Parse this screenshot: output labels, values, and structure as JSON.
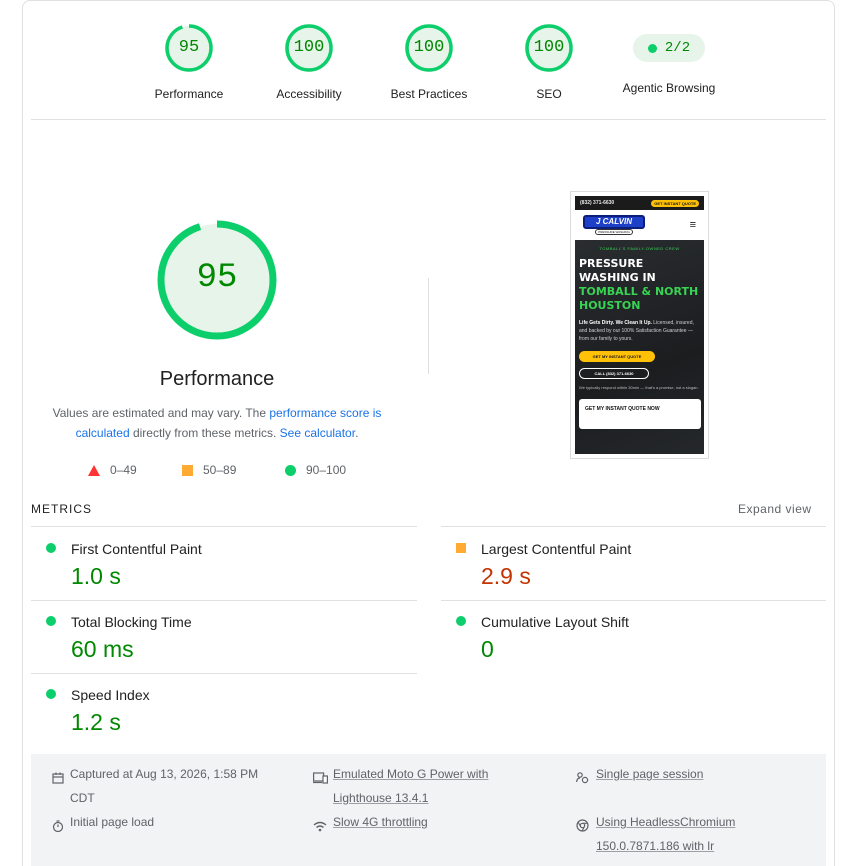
{
  "gauges": [
    {
      "score": "95",
      "label": "Performance"
    },
    {
      "score": "100",
      "label": "Accessibility"
    },
    {
      "score": "100",
      "label": "Best Practices"
    },
    {
      "score": "100",
      "label": "SEO"
    }
  ],
  "agentic": {
    "value": "2/2",
    "label": "Agentic Browsing"
  },
  "main": {
    "score": "95",
    "score_fraction": 0.95,
    "title": "Performance",
    "desc_part1": "Values are estimated and may vary. The ",
    "desc_link1": "performance score is calculated",
    "desc_part2": " directly from these metrics. ",
    "desc_link2": "See calculator",
    "desc_part3": "."
  },
  "legend": {
    "fail": "0–49",
    "average": "50–89",
    "pass": "90–100"
  },
  "colors": {
    "pass": "#0cce6b",
    "average": "#ffaa33",
    "fail": "#ff3333",
    "pass_text": "#008800",
    "average_text": "#c33300",
    "link": "#1a73e8"
  },
  "screenshot": {
    "phone": "(832) 371-6630",
    "top_button": "GET INSTANT QUOTE",
    "logo": "J CALVIN",
    "logo_sub": "PRESSURE WASHING",
    "eyebrow": "TOMBALL'S FAMILY-OWNED CREW",
    "headline_white": "PRESSURE WASHING IN",
    "headline_green1": "TOMBALL & NORTH",
    "headline_green2": "HOUSTON",
    "para_bold": "Life Gets Dirty. We Clean It Up.",
    "para_rest": " Licensed, insured, and backed by our 100% Satisfaction Guarantee — from our family to yours.",
    "btn_quote": "GET MY INSTANT QUOTE",
    "btn_call": "CALL (832) 371-6630",
    "small_note": "We typically respond within 30min — that's a promise, not a slogan.",
    "card_title": "GET MY INSTANT QUOTE NOW"
  },
  "metrics": {
    "heading": "METRICS",
    "expand": "Expand view",
    "fcp": {
      "name": "First Contentful Paint",
      "value": "1.0 s"
    },
    "lcp": {
      "name": "Largest Contentful Paint",
      "value": "2.9 s"
    },
    "tbt": {
      "name": "Total Blocking Time",
      "value": "60 ms"
    },
    "cls": {
      "name": "Cumulative Layout Shift",
      "value": "0"
    },
    "si": {
      "name": "Speed Index",
      "value": "1.2 s"
    }
  },
  "footer": {
    "captured": "Captured at Aug 13, 2026, 1:58 PM CDT",
    "emulated": "Emulated Moto G Power with Lighthouse 13.4.1",
    "session": "Single page session",
    "load": "Initial page load",
    "throttling": "Slow 4G throttling",
    "browser": "Using HeadlessChromium 150.0.7871.186 with lr"
  }
}
